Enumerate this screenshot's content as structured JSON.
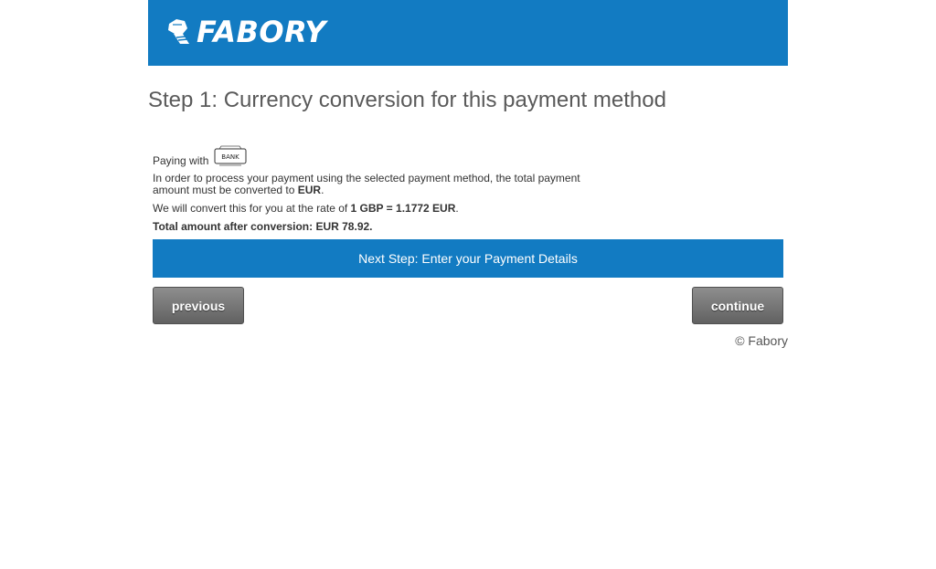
{
  "brand": {
    "logo_text": "FABORY",
    "color": "#127bc2"
  },
  "page": {
    "title": "Step 1: Currency conversion for this payment method"
  },
  "payment": {
    "paying_with": "Paying with",
    "method_icon": "bank-icon",
    "method_icon_text": "BANK",
    "notice_prefix": "In order to process your payment using the selected payment method, the total payment amount must be converted to ",
    "notice_currency": "EUR",
    "notice_suffix": ".",
    "rate_prefix": "We will convert this for you at the rate of ",
    "rate_value": "1 GBP = 1.1772 EUR",
    "rate_suffix": ".",
    "total": "Total amount after conversion: EUR 78.92."
  },
  "next_step": {
    "label": "Next Step: Enter your Payment Details"
  },
  "buttons": {
    "previous": "previous",
    "continue": "continue"
  },
  "footer": {
    "copyright": "© Fabory"
  }
}
